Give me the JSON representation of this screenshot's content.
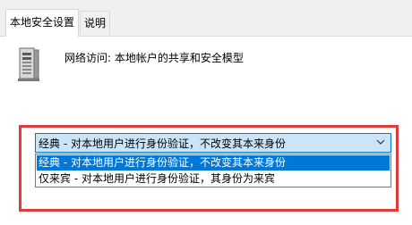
{
  "tabs": [
    {
      "label": "本地安全设置",
      "active": true
    },
    {
      "label": "说明",
      "active": false
    }
  ],
  "policy": {
    "icon": "computer-tower-icon",
    "title": "网络访问: 本地帐户的共享和安全模型"
  },
  "select": {
    "value": "经典 - 对本地用户进行身份验证，不改变其本来身份",
    "options": [
      {
        "label": "经典 - 对本地用户进行身份验证，不改变其本来身份",
        "selected": true
      },
      {
        "label": "仅来宾 - 对本地用户进行身份验证，其身份为来宾",
        "selected": false
      }
    ]
  },
  "colors": {
    "highlight": "#e03b3b",
    "accent": "#0078d7",
    "select_bg": "#cce4f7"
  }
}
